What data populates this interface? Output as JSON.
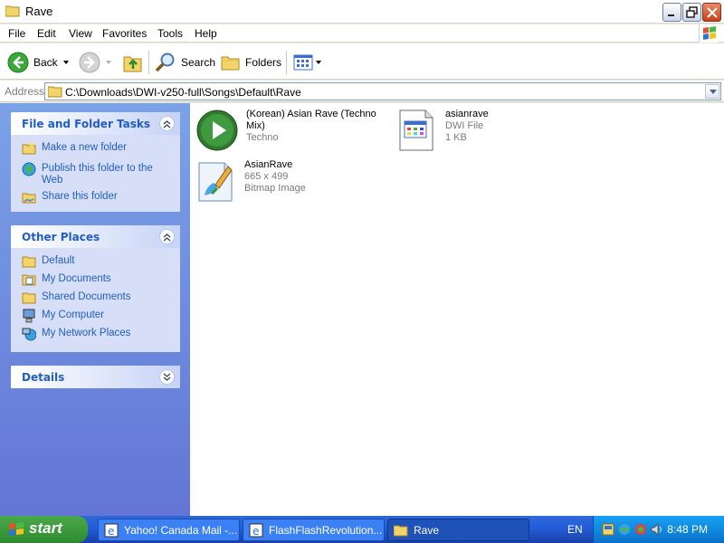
{
  "window": {
    "title": "Rave"
  },
  "menu": [
    "File",
    "Edit",
    "View",
    "Favorites",
    "Tools",
    "Help"
  ],
  "toolbar": {
    "back_label": "Back",
    "search_label": "Search",
    "folders_label": "Folders"
  },
  "address": {
    "label": "Address",
    "path": "C:\\Downloads\\DWI-v250-full\\Songs\\Default\\Rave"
  },
  "taskpane": {
    "file_tasks": {
      "title": "File and Folder Tasks",
      "items": [
        "Make a new folder",
        "Publish this folder to the Web",
        "Share this folder"
      ]
    },
    "other_places": {
      "title": "Other Places",
      "items": [
        "Default",
        "My Documents",
        "Shared Documents",
        "My Computer",
        "My Network Places"
      ]
    },
    "details": {
      "title": "Details"
    }
  },
  "files": [
    {
      "name": "(Korean) Asian Rave (Techno Mix)",
      "lines": [
        "Techno"
      ],
      "icon": "media-play-icon"
    },
    {
      "name": "asianrave",
      "lines": [
        "DWI File",
        "1 KB"
      ],
      "icon": "dwi-file-icon"
    },
    {
      "name": "AsianRave",
      "lines": [
        "665 x 499",
        "Bitmap Image"
      ],
      "icon": "bitmap-image-icon"
    }
  ],
  "taskbar": {
    "start_label": "start",
    "buttons": [
      "Yahoo! Canada Mail -...",
      "FlashFlashRevolution...",
      "Rave"
    ],
    "language": "EN",
    "clock": "8:48 PM"
  },
  "colors": {
    "taskbar_blue": "#245edb",
    "start_green": "#3c9b3c",
    "link_blue": "#215dc6",
    "pane_blue": "#7ba2e7"
  }
}
